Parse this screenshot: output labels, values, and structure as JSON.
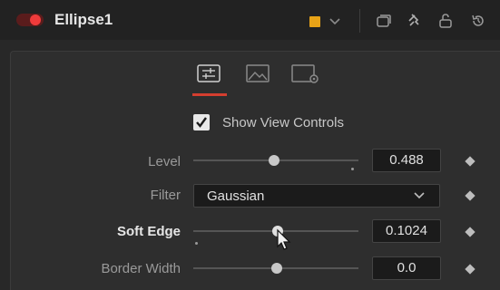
{
  "header": {
    "title": "Ellipse1",
    "color_swatch": "#e8a317",
    "icons": [
      "visibility-toggle",
      "color-swatch",
      "chevron-down-icon",
      "window-icon",
      "pin-icon",
      "lock-icon",
      "reset-icon"
    ]
  },
  "tabs": [
    {
      "name": "controls-tab-icon",
      "active": true
    },
    {
      "name": "image-tab-icon",
      "active": false
    },
    {
      "name": "settings-tab-icon",
      "active": false
    }
  ],
  "show_view_controls": {
    "label": "Show View Controls",
    "checked": true
  },
  "controls": {
    "level": {
      "label": "Level",
      "value": "0.488",
      "slider_fraction": 0.488
    },
    "filter": {
      "label": "Filter",
      "selected": "Gaussian"
    },
    "soft_edge": {
      "label": "Soft Edge",
      "value": "0.1024",
      "slider_fraction": 0.51
    },
    "border_width": {
      "label": "Border Width",
      "value": "0.0",
      "slider_fraction": 0.5
    }
  },
  "accent_color": "#d43e2f"
}
